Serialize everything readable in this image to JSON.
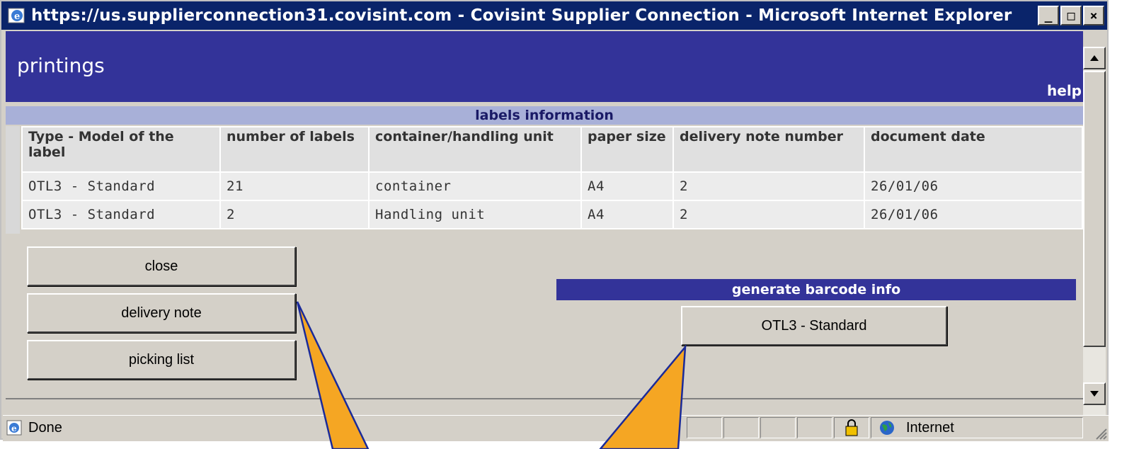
{
  "window": {
    "title": "https://us.supplierconnection31.covisint.com - Covisint Supplier Connection - Microsoft Internet Explorer",
    "controls": [
      "_",
      "□",
      "×"
    ]
  },
  "page": {
    "title": "printings",
    "help": "help"
  },
  "labels_section": {
    "title": "labels information",
    "columns": [
      "Type - Model of the label",
      "number of labels",
      "container/handling unit",
      "paper size",
      "delivery note number",
      "document date"
    ],
    "rows": [
      [
        "OTL3 - Standard",
        "21",
        "container",
        "A4",
        "2",
        "26/01/06"
      ],
      [
        "OTL3 - Standard",
        "2",
        "Handling unit",
        "A4",
        "2",
        "26/01/06"
      ]
    ]
  },
  "buttons": {
    "close": "close",
    "delivery_note": "delivery note",
    "picking_list": "picking list"
  },
  "barcode": {
    "title": "generate barcode info",
    "button": "OTL3 - Standard"
  },
  "status": {
    "text": "Done",
    "zone": "Internet"
  },
  "colors": {
    "header_bg": "#333399",
    "section_bar": "#a8b0d8",
    "callout_fill": "#f5a623",
    "callout_stroke": "#1a2a99"
  }
}
